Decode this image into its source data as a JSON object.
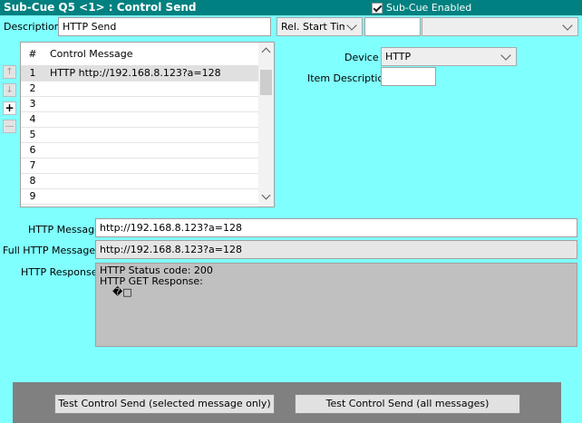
{
  "header": {
    "title": "Sub-Cue Q5 <1> : Control Send",
    "subcue_enabled_label": "Sub-Cue Enabled",
    "subcue_enabled": true
  },
  "description": {
    "label": "Description",
    "value": "HTTP Send"
  },
  "timing": {
    "mode": "Rel. Start Time",
    "time_value": "",
    "extra_value": ""
  },
  "grid": {
    "columns": [
      "#",
      "Control Message"
    ],
    "rows": [
      {
        "num": "1",
        "message": "HTTP http://192.168.8.123?a=128"
      },
      {
        "num": "2",
        "message": ""
      },
      {
        "num": "3",
        "message": ""
      },
      {
        "num": "4",
        "message": ""
      },
      {
        "num": "5",
        "message": ""
      },
      {
        "num": "6",
        "message": ""
      },
      {
        "num": "7",
        "message": ""
      },
      {
        "num": "8",
        "message": ""
      },
      {
        "num": "9",
        "message": ""
      }
    ]
  },
  "side_buttons": {
    "up": "↑",
    "down": "↓",
    "add": "+",
    "remove": "—"
  },
  "device": {
    "label": "Device",
    "value": "HTTP"
  },
  "item_description": {
    "label": "Item Description",
    "value": ""
  },
  "http": {
    "message_label": "HTTP Message",
    "message_value": "http://192.168.8.123?a=128",
    "full_label": "Full HTTP Message",
    "full_value": "http://192.168.8.123?a=128",
    "response_label": "HTTP Response",
    "response_lines": [
      "HTTP Status code: 200",
      "HTTP GET Response:",
      "    �□"
    ]
  },
  "buttons": {
    "test_selected": "Test Control Send (selected message only)",
    "test_all": "Test Control Send (all messages)"
  },
  "colors": {
    "background": "#80ffff",
    "title_bar": "#008080"
  }
}
